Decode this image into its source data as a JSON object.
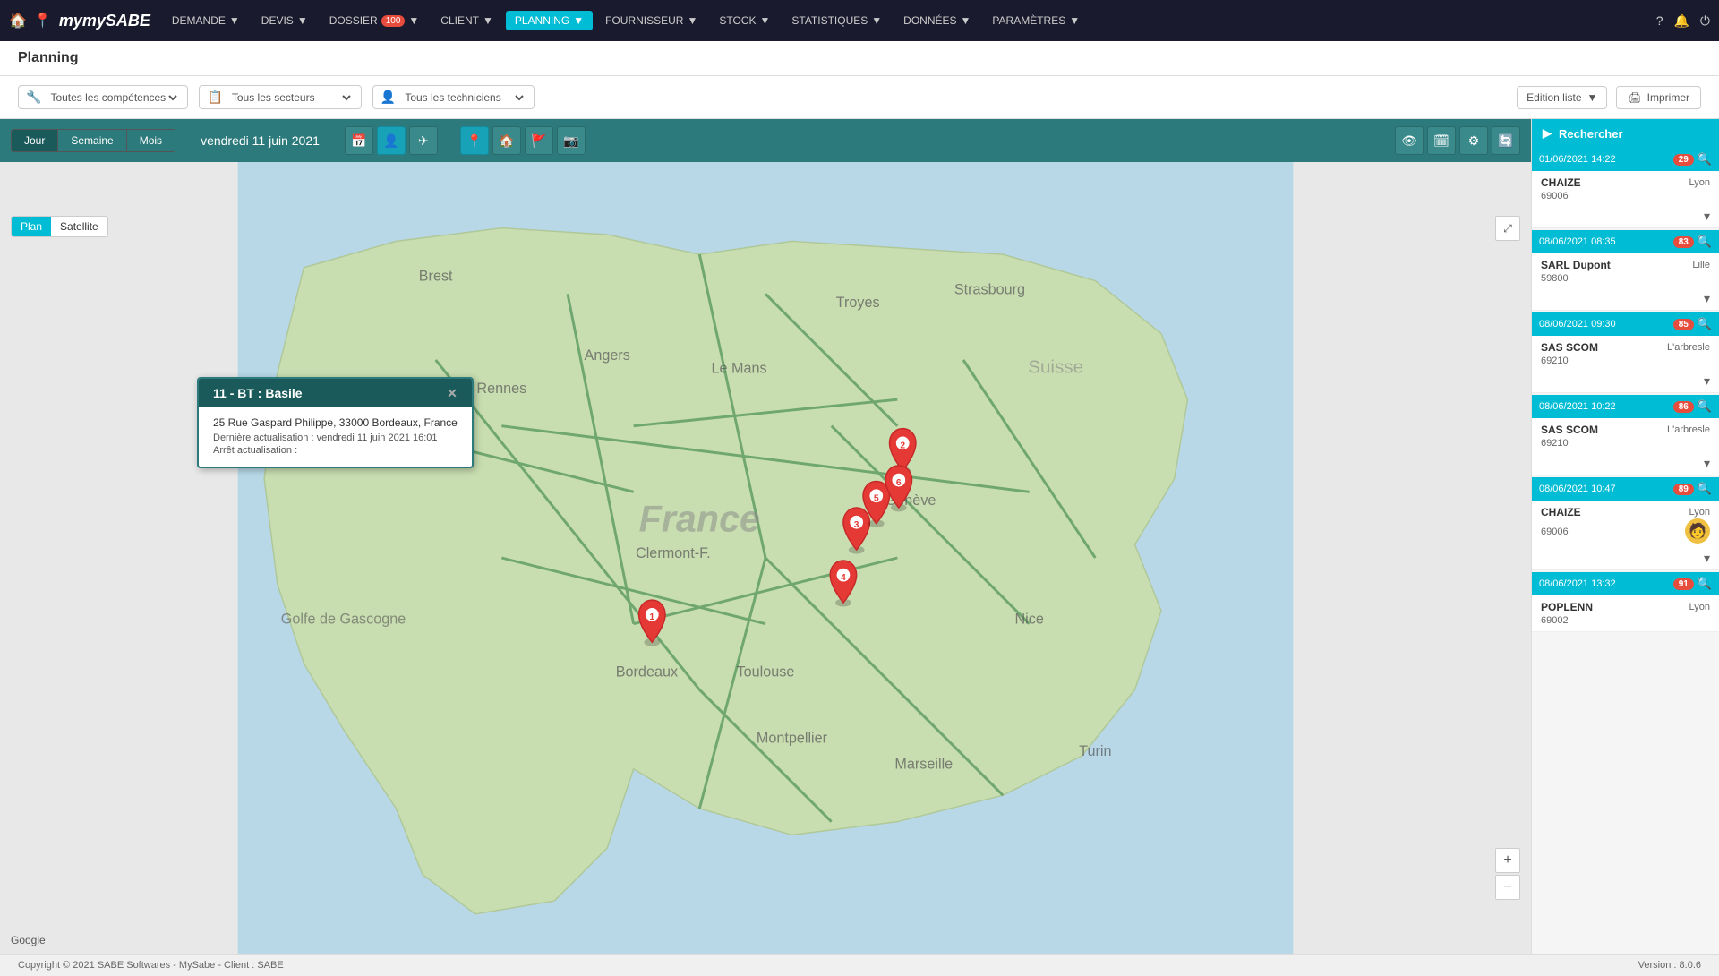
{
  "app": {
    "logo": "mySABE",
    "version": "8.0.6",
    "copyright": "Copyright © 2021 SABE Softwares - MySabe - Client : SABE"
  },
  "nav": {
    "items": [
      {
        "label": "DEMANDE",
        "badge": "",
        "active": false
      },
      {
        "label": "DEVIS",
        "badge": "",
        "active": false
      },
      {
        "label": "DOSSIER",
        "badge": "100",
        "active": false
      },
      {
        "label": "CLIENT",
        "badge": "",
        "active": false
      },
      {
        "label": "PLANNING",
        "badge": "",
        "active": true
      },
      {
        "label": "FOURNISSEUR",
        "badge": "",
        "active": false
      },
      {
        "label": "STOCK",
        "badge": "",
        "active": false
      },
      {
        "label": "STATISTIQUES",
        "badge": "",
        "active": false
      },
      {
        "label": "DONNÉES",
        "badge": "",
        "active": false
      },
      {
        "label": "PARAMÈTRES",
        "badge": "",
        "active": false
      }
    ]
  },
  "page": {
    "title": "Planning"
  },
  "filters": {
    "competences_label": "Toutes les compétences",
    "secteurs_label": "Tous les secteurs",
    "techniciens_label": "Tous les techniciens",
    "edition_label": "Edition liste",
    "imprimer_label": "Imprimer"
  },
  "planning": {
    "view_tabs": [
      "Jour",
      "Semaine",
      "Mois"
    ],
    "active_tab": "Jour",
    "current_date": "vendredi 11 juin 2021",
    "map_views": [
      "Plan",
      "Satellite"
    ],
    "active_map_view": "Plan"
  },
  "popup": {
    "title": "11 - BT : Basile",
    "address": "25 Rue Gaspard Philippe, 33000 Bordeaux, France",
    "last_update_label": "Dernière actualisation :",
    "last_update_value": "vendredi 11 juin 2021 16:01",
    "arret_label": "Arrêt actualisation :"
  },
  "right_panel": {
    "header": "Rechercher",
    "cards": [
      {
        "date": "01/06/2021 14:22",
        "badge": "29",
        "name": "CHAIZE",
        "code": "69006",
        "city": "Lyon"
      },
      {
        "date": "08/06/2021 08:35",
        "badge": "83",
        "name": "SARL Dupont",
        "code": "59800",
        "city": "Lille"
      },
      {
        "date": "08/06/2021 09:30",
        "badge": "85",
        "name": "SAS SCOM",
        "code": "69210",
        "city": "L'arbresle"
      },
      {
        "date": "08/06/2021 10:22",
        "badge": "86",
        "name": "SAS SCOM",
        "code": "69210",
        "city": "L'arbresle"
      },
      {
        "date": "08/06/2021 10:47",
        "badge": "89",
        "name": "CHAIZE",
        "code": "69006",
        "city": "Lyon",
        "has_avatar": true
      },
      {
        "date": "08/06/2021 13:32",
        "badge": "91",
        "name": "POPLENN",
        "code": "69002",
        "city": "Lyon"
      }
    ]
  },
  "map_pins": [
    {
      "id": "1",
      "label": "1",
      "x": "26",
      "y": "73"
    },
    {
      "id": "2",
      "label": "2",
      "x": "61",
      "y": "42"
    },
    {
      "id": "3",
      "label": "3",
      "x": "58",
      "y": "56"
    },
    {
      "id": "4",
      "label": "4",
      "x": "55",
      "y": "64"
    },
    {
      "id": "5",
      "label": "5",
      "x": "56",
      "y": "49"
    },
    {
      "id": "6",
      "label": "6",
      "x": "59",
      "y": "52"
    }
  ]
}
